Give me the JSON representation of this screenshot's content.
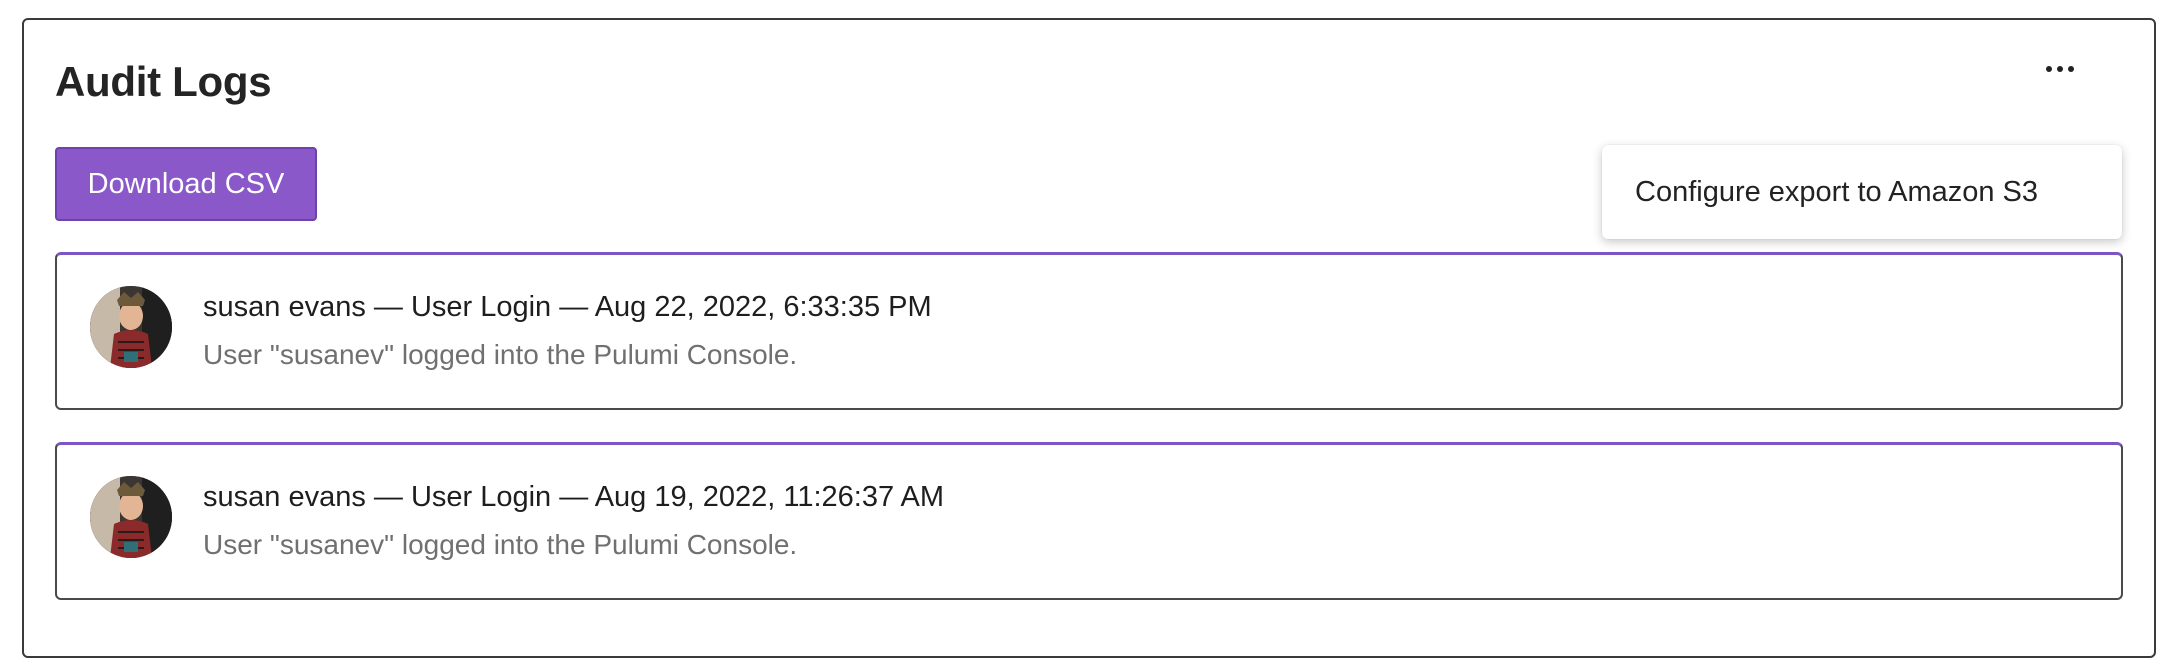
{
  "header": {
    "title": "Audit Logs"
  },
  "toolbar": {
    "download_label": "Download CSV"
  },
  "menu": {
    "items": [
      {
        "label": "Configure export to Amazon S3"
      }
    ]
  },
  "logs": [
    {
      "user": "susan evans",
      "event": "User Login",
      "timestamp": "Aug 22, 2022, 6:33:35 PM",
      "heading": "susan evans — User Login — Aug 22, 2022, 6:33:35 PM",
      "description": "User \"susanev\" logged into the Pulumi Console."
    },
    {
      "user": "susan evans",
      "event": "User Login",
      "timestamp": "Aug 19, 2022, 11:26:37 AM",
      "heading": "susan evans — User Login — Aug 19, 2022, 11:26:37 AM",
      "description": "User \"susanev\" logged into the Pulumi Console."
    }
  ],
  "colors": {
    "accent": "#8a58c8",
    "card_top_border": "#7e55c4"
  },
  "icons": {
    "more": "more-horizontal-icon"
  }
}
